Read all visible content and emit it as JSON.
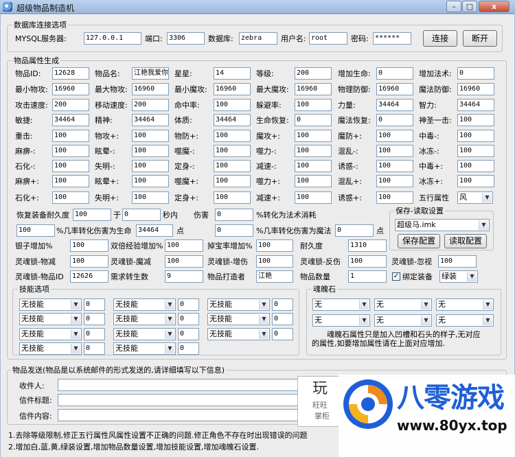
{
  "window": {
    "title": "超级物品制造机",
    "minimize": "–",
    "maximize": "□",
    "close": "x"
  },
  "db": {
    "group_title": "数据库连接选项",
    "server_label": "MYSQL服务器:",
    "server_value": "127.0.0.1",
    "port_label": "端口:",
    "port_value": "3306",
    "database_label": "数据库:",
    "database_value": "zebra",
    "user_label": "用户名:",
    "user_value": "root",
    "password_label": "密码:",
    "password_value": "******",
    "connect_label": "连接",
    "disconnect_label": "断开"
  },
  "attrs": {
    "group_title": "物品属性生成",
    "rows": [
      [
        {
          "label": "物品ID:",
          "value": "12628"
        },
        {
          "label": "物品名:",
          "value": "江艳我爱你"
        },
        {
          "label": "星星:",
          "value": "14"
        },
        {
          "label": "等级:",
          "value": "200"
        },
        {
          "label": "增加生命:",
          "value": "0"
        },
        {
          "label": "增加法术:",
          "value": "0"
        }
      ],
      [
        {
          "label": "最小物攻:",
          "value": "16960"
        },
        {
          "label": "最大物攻:",
          "value": "16960"
        },
        {
          "label": "最小魔攻:",
          "value": "16960"
        },
        {
          "label": "最大魔攻:",
          "value": "16960"
        },
        {
          "label": "物理防御:",
          "value": "16960"
        },
        {
          "label": "魔法防御:",
          "value": "16960"
        }
      ],
      [
        {
          "label": "攻击速度:",
          "value": "200"
        },
        {
          "label": "移动速度:",
          "value": "200"
        },
        {
          "label": "命中率:",
          "value": "100"
        },
        {
          "label": "躲避率:",
          "value": "100"
        },
        {
          "label": "力量:",
          "value": "34464"
        },
        {
          "label": "智力:",
          "value": "34464"
        }
      ],
      [
        {
          "label": "敏捷:",
          "value": "34464"
        },
        {
          "label": "精神:",
          "value": "34464"
        },
        {
          "label": "体质:",
          "value": "34464"
        },
        {
          "label": "生命恢复:",
          "value": "0"
        },
        {
          "label": "魔法恢复:",
          "value": "0"
        },
        {
          "label": "神圣一击:",
          "value": "100"
        }
      ],
      [
        {
          "label": "重击:",
          "value": "100"
        },
        {
          "label": "物攻+:",
          "value": "100"
        },
        {
          "label": "物防+:",
          "value": "100"
        },
        {
          "label": "魔攻+:",
          "value": "100"
        },
        {
          "label": "魔防+:",
          "value": "100"
        },
        {
          "label": "中毒-:",
          "value": "100"
        }
      ],
      [
        {
          "label": "麻痹-:",
          "value": "100"
        },
        {
          "label": "眩晕-:",
          "value": "100"
        },
        {
          "label": "噬魔-:",
          "value": "100"
        },
        {
          "label": "噬力-:",
          "value": "100"
        },
        {
          "label": "混乱-:",
          "value": "100"
        },
        {
          "label": "冰冻-:",
          "value": "100"
        }
      ],
      [
        {
          "label": "石化-:",
          "value": "100"
        },
        {
          "label": "失明-:",
          "value": "100"
        },
        {
          "label": "定身-:",
          "value": "100"
        },
        {
          "label": "减速-:",
          "value": "100"
        },
        {
          "label": "诱惑-:",
          "value": "100"
        },
        {
          "label": "中毒+:",
          "value": "100"
        }
      ],
      [
        {
          "label": "麻痹+:",
          "value": "100"
        },
        {
          "label": "眩晕+:",
          "value": "100"
        },
        {
          "label": "噬魔+:",
          "value": "100"
        },
        {
          "label": "噬力+:",
          "value": "100"
        },
        {
          "label": "混乱+:",
          "value": "100"
        },
        {
          "label": "冰冻+:",
          "value": "100"
        }
      ],
      [
        {
          "label": "石化+:",
          "value": "100"
        },
        {
          "label": "失明+:",
          "value": "100"
        },
        {
          "label": "定身+:",
          "value": "100"
        },
        {
          "label": "减速+:",
          "value": "100"
        },
        {
          "label": "诱惑+:",
          "value": "100"
        },
        {
          "label": "五行属性",
          "value": "风"
        }
      ]
    ],
    "restore_label": "恢复装备耐久度",
    "restore_value": "100",
    "yu_label": "于",
    "yu_value": "0",
    "sec_label": "秒内",
    "damage_label": "伤害",
    "damage_value": "0",
    "pct_mp_label": "%转化为法术消耗",
    "conv_pct_value": "100",
    "conv_hp_label": "%几率转化伤害为生命",
    "conv_hp_value": "34464",
    "point1_label": "点",
    "conv_mp_pct_value": "0",
    "conv_mp_label": "%几率转化伤害为魔法",
    "conv_mp_value": "0",
    "point2_label": "点",
    "silver_label": "银子增加%",
    "silver_value": "100",
    "exp_label": "双倍经验增加%",
    "exp_value": "100",
    "treasure_label": "掉宝率增加%",
    "treasure_value": "100",
    "durability_label": "耐久度",
    "durability_value": "1310",
    "soul_wu_label": "灵魂锁-物减",
    "soul_wu_value": "100",
    "soul_mo_label": "灵魂锁-魔减",
    "soul_mo_value": "100",
    "soul_zeng_label": "灵魂锁-增伤",
    "soul_zeng_value": "100",
    "soul_fan_label": "灵魂锁-反伤",
    "soul_fan_value": "100",
    "soul_hu_label": "灵魂锁-忽视",
    "soul_hu_value": "100",
    "soul_id_label": "灵魂锁-物品ID",
    "soul_id_value": "12626",
    "rebirth_label": "需求转生数",
    "rebirth_value": "9",
    "maker_label": "物品打造者",
    "maker_value": "江艳",
    "qty_label": "物品数量",
    "qty_value": "1",
    "bind_checked": "✓",
    "bind_label": "绑定装备",
    "bind_select": "绿装"
  },
  "save": {
    "group_title": "保存-读取设置",
    "file_select": "超级马.imk",
    "save_btn": "保存配置",
    "load_btn": "读取配置"
  },
  "skills": {
    "group_title": "技能选项",
    "option": "无技能",
    "value": "0"
  },
  "soulstone": {
    "group_title": "魂魄石",
    "option": "无",
    "note_line1": "魂魄石属性只是加入凹槽和石头的样子,无对应",
    "note_line2": "的属性,如要增加属性请在上面对应增加."
  },
  "send": {
    "group_title": "物品发送(物品是以系统邮件的形式发送的,请详细填写以下信息)",
    "recipient_label": "收件人:",
    "subject_label": "信件标题:",
    "content_label": "信件内容:"
  },
  "footer": {
    "line1": "1.去除等级限制,修正五行属性风属性设置不正确的问题.修正角色不存在时出现错误的问题",
    "line2": "2.增加白,蓝,黄,绿装设置,增加物品数量设置,增加技能设置,增加魂魄石设置."
  },
  "watermark": {
    "cn": "八零游戏",
    "url": "www.80yx.top",
    "behind1": "玩",
    "behind2": "旺旺",
    "behind3": "掌柜"
  },
  "colors": {
    "logo_blue": "#1e5fd8",
    "logo_orange": "#f08a1c",
    "titlebar": "#bcd3ee",
    "client": "#ececec"
  }
}
